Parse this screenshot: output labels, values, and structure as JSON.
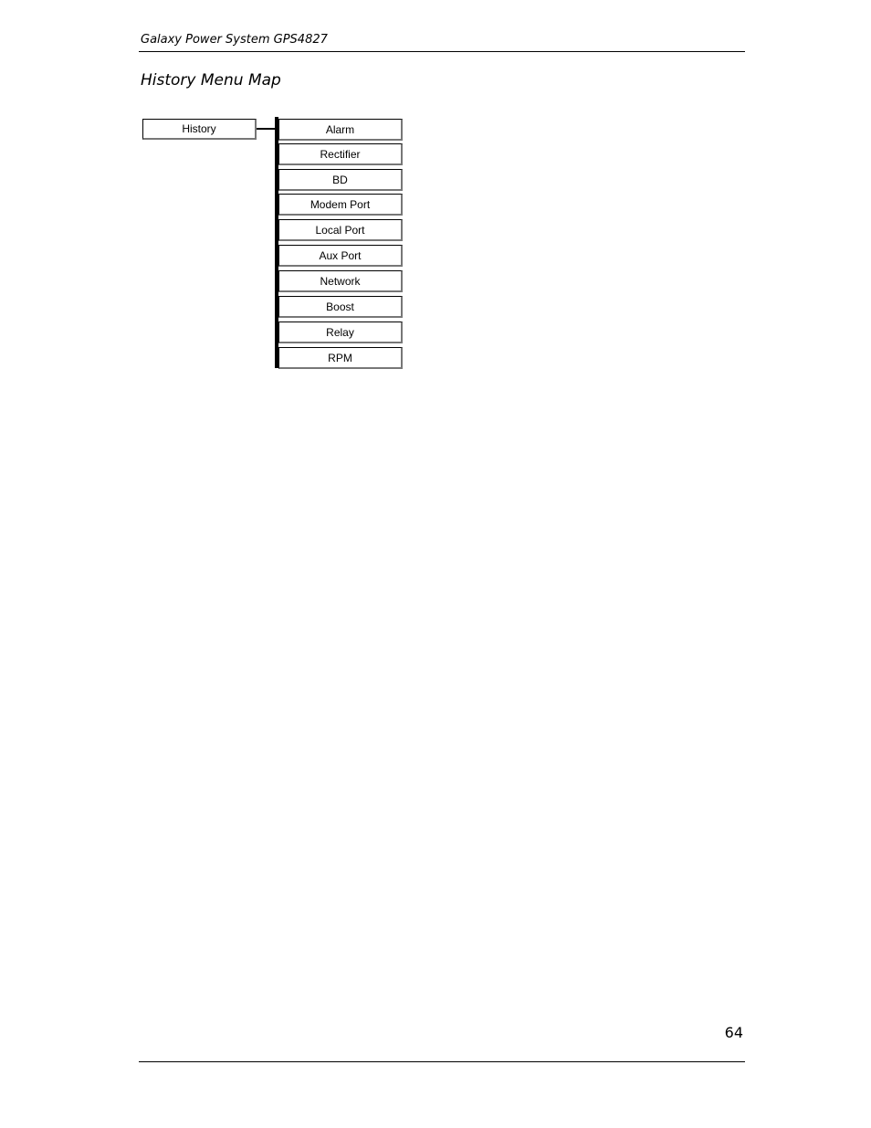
{
  "header": {
    "title": "Galaxy Power System GPS4827"
  },
  "section": {
    "title": "History Menu Map"
  },
  "menu_map": {
    "root": "History",
    "children": [
      "Alarm",
      "Rectifier",
      "BD",
      "Modem Port",
      "Local Port",
      "Aux Port",
      "Network",
      "Boost",
      "Relay",
      "RPM"
    ]
  },
  "footer": {
    "page_number": "64"
  }
}
